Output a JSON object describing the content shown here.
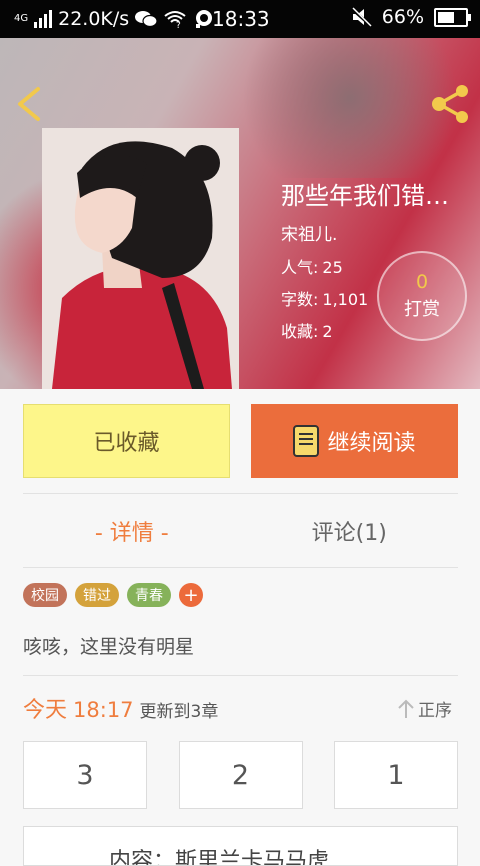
{
  "status_bar": {
    "network_type": "4G",
    "speed": "22.0K/s",
    "time": "18:33",
    "battery": "66%",
    "battery_level": 0.66
  },
  "book": {
    "title": "那些年我们错…",
    "author": "宋祖儿.",
    "popularity_label": "人气:",
    "popularity_value": "25",
    "words_label": "字数:",
    "words_value": "1,101",
    "favorites_label": "收藏:",
    "favorites_value": "2",
    "reward_count": "0",
    "reward_label": "打赏"
  },
  "actions": {
    "favorited_label": "已收藏",
    "continue_label": "继续阅读"
  },
  "tabs": [
    {
      "label": "- 详情 -",
      "active": true
    },
    {
      "label": "评论(1)",
      "active": false
    }
  ],
  "tags": [
    {
      "label": "校园",
      "color": "#c2735a"
    },
    {
      "label": "错过",
      "color": "#d4a23b"
    },
    {
      "label": "青春",
      "color": "#86b25a"
    }
  ],
  "tag_add": "+",
  "description": "咳咳，这里没有明星",
  "update": {
    "day": "今天",
    "time": "18:17",
    "text": "更新到3章",
    "order_label": "正序"
  },
  "chapters": [
    "3",
    "2",
    "1"
  ],
  "latest_chapter": "内容：斯里兰卡马马虎",
  "colors": {
    "accent": "#ef7d3e",
    "favorite_bg": "#fdf68a",
    "read_bg": "#eb6d3c",
    "icon_yellow": "#f2c94c"
  }
}
